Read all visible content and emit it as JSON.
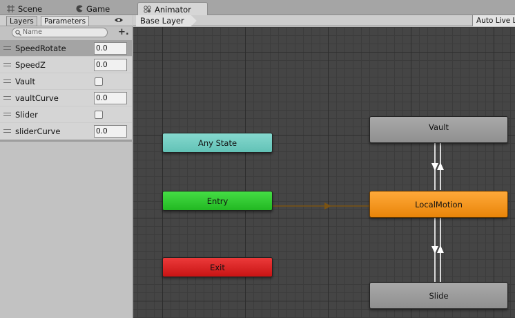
{
  "tabs": [
    {
      "label": "Scene",
      "icon": "grid-icon"
    },
    {
      "label": "Game",
      "icon": "pacman-icon"
    },
    {
      "label": "Animator",
      "icon": "animator-icon"
    }
  ],
  "left_panel": {
    "tabs": [
      "Layers",
      "Parameters"
    ],
    "search_placeholder": "Name",
    "add_label": "+.",
    "parameters": [
      {
        "name": "SpeedRotate",
        "type": "float",
        "value": "0.0"
      },
      {
        "name": "SpeedZ",
        "type": "float",
        "value": "0.0"
      },
      {
        "name": "Vault",
        "type": "bool",
        "checked": false
      },
      {
        "name": "vaultCurve",
        "type": "float",
        "value": "0.0"
      },
      {
        "name": "Slider",
        "type": "bool",
        "checked": false
      },
      {
        "name": "sliderCurve",
        "type": "float",
        "value": "0.0"
      }
    ]
  },
  "breadcrumb": "Base Layer",
  "auto_live_link": "Auto Live L",
  "graph": {
    "states": {
      "any_state": "Any State",
      "entry": "Entry",
      "exit": "Exit",
      "vault": "Vault",
      "local_motion": "LocalMotion",
      "slide": "Slide"
    }
  },
  "colors": {
    "any_state": "#70cbbf",
    "entry": "#2fc92f",
    "exit": "#d91f1f",
    "default_state": "#f3941c",
    "state": "#9a9a9a",
    "transition": "#ffffff",
    "entry_transition": "#7a5313"
  }
}
